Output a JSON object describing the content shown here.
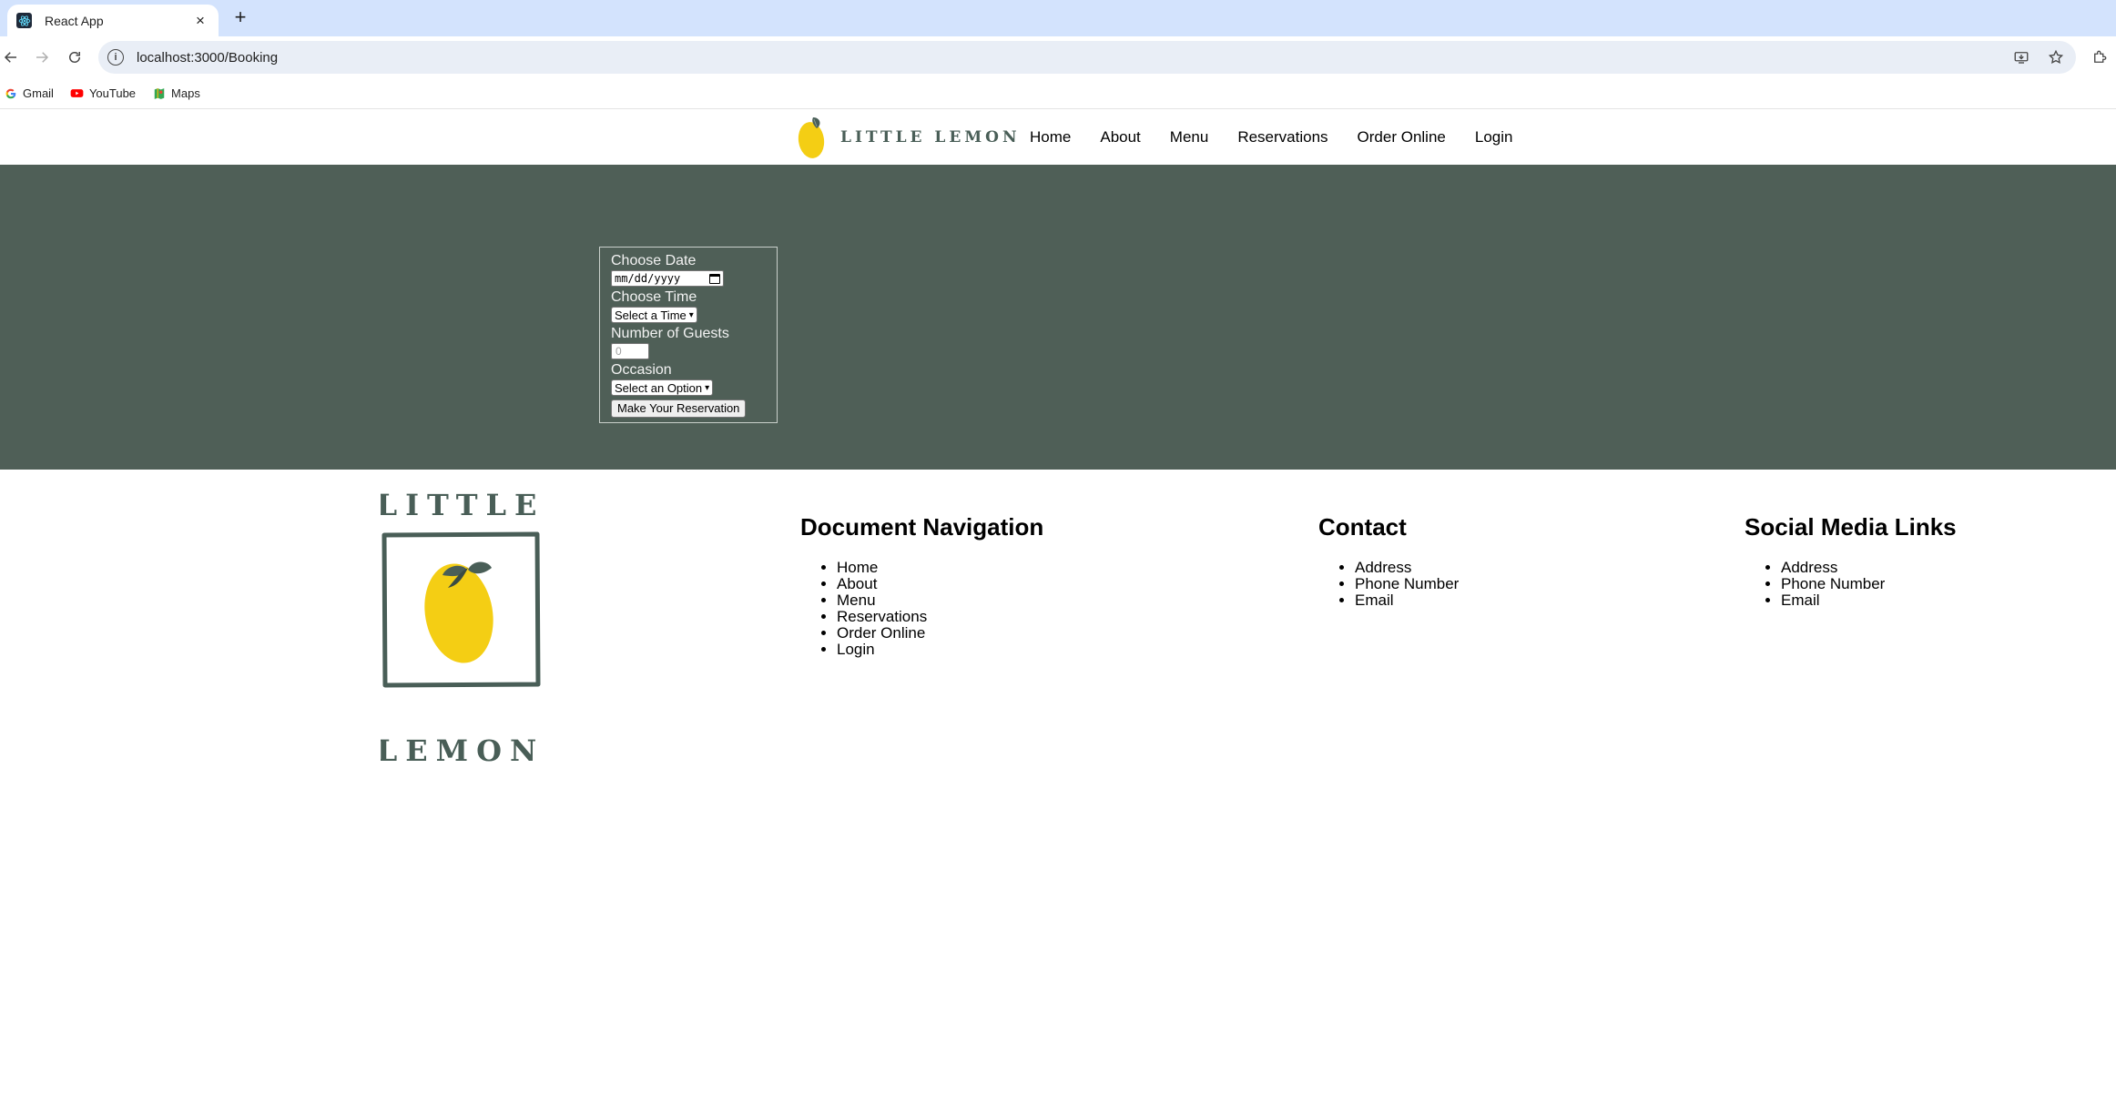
{
  "browser": {
    "tab_title": "React App",
    "tab_close": "×",
    "new_tab": "+",
    "url": "localhost:3000/Booking",
    "bookmarks": [
      {
        "label": "Gmail"
      },
      {
        "label": "YouTube"
      },
      {
        "label": "Maps"
      }
    ]
  },
  "header": {
    "logo_text": "LITTLE LEMON",
    "nav": [
      "Home",
      "About",
      "Menu",
      "Reservations",
      "Order Online",
      "Login"
    ]
  },
  "booking": {
    "date_label": "Choose Date",
    "date_placeholder": "mm/dd/yyyy",
    "time_label": "Choose Time",
    "time_selected": "Select a Time",
    "guests_label": "Number of Guests",
    "guests_placeholder": "0",
    "occasion_label": "Occasion",
    "occasion_selected": "Select an Option",
    "submit_label": "Make Your Reservation"
  },
  "footer": {
    "logo_top": "LITTLE",
    "logo_bottom": "LEMON",
    "nav_title": "Document Navigation",
    "nav_items": [
      "Home",
      "About",
      "Menu",
      "Reservations",
      "Order Online",
      "Login"
    ],
    "contact_title": "Contact",
    "contact_items": [
      "Address",
      "Phone Number",
      "Email"
    ],
    "social_title": "Social Media Links",
    "social_items": [
      "Address",
      "Phone Number",
      "Email"
    ]
  },
  "colors": {
    "hero_bg": "#4f5f57",
    "brand_green": "#495e57",
    "brand_yellow": "#f4ce14",
    "tabbar_bg": "#d3e3fd"
  }
}
